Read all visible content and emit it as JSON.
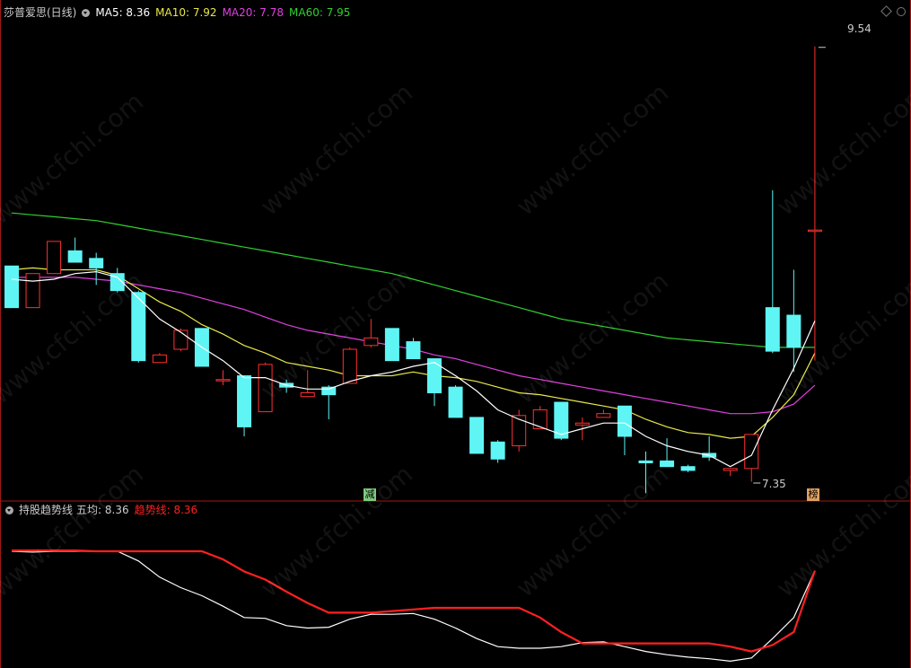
{
  "main_panel": {
    "title": "莎普爱思(日线)",
    "ma_labels": [
      {
        "label": "MA5: 8.36",
        "color": "#ffffff"
      },
      {
        "label": "MA10: 7.92",
        "color": "#e8e84a"
      },
      {
        "label": "MA20: 7.78",
        "color": "#e040e0"
      },
      {
        "label": "MA60: 7.95",
        "color": "#30d030"
      }
    ],
    "high_label": "9.54",
    "low_label": "7.35",
    "badges": [
      {
        "text": "减",
        "color": "#7ec97e"
      },
      {
        "text": "榜",
        "color": "#e0a060"
      }
    ]
  },
  "sub_panel": {
    "title": "持股趋势线",
    "avg_label": "五均: 8.36",
    "trend_label": "趋势线: 8.36",
    "trend_color": "#ff2020",
    "avg_color": "#ffffff"
  },
  "watermark": "www.cfchi.com",
  "colors": {
    "up": "#ff3030",
    "down": "#5ff5f5",
    "ma5": "#ffffff",
    "ma10": "#e8e84a",
    "ma20": "#e040e0",
    "ma60": "#30d030",
    "border": "#a01818"
  },
  "chart_data": {
    "type": "candlestick",
    "ylim": [
      7.2,
      9.7
    ],
    "candles": [
      {
        "o": 8.38,
        "h": 8.38,
        "l": 8.16,
        "c": 8.16
      },
      {
        "o": 8.16,
        "h": 8.34,
        "l": 8.16,
        "c": 8.34
      },
      {
        "o": 8.34,
        "h": 8.51,
        "l": 8.34,
        "c": 8.51
      },
      {
        "o": 8.46,
        "h": 8.53,
        "l": 8.4,
        "c": 8.4
      },
      {
        "o": 8.42,
        "h": 8.45,
        "l": 8.28,
        "c": 8.37
      },
      {
        "o": 8.34,
        "h": 8.37,
        "l": 8.24,
        "c": 8.25
      },
      {
        "o": 8.24,
        "h": 8.25,
        "l": 7.87,
        "c": 7.88
      },
      {
        "o": 7.87,
        "h": 7.92,
        "l": 7.87,
        "c": 7.91
      },
      {
        "o": 7.94,
        "h": 8.05,
        "l": 7.93,
        "c": 8.04
      },
      {
        "o": 8.05,
        "h": 8.05,
        "l": 7.85,
        "c": 7.85
      },
      {
        "o": 7.78,
        "h": 7.83,
        "l": 7.75,
        "c": 7.78
      },
      {
        "o": 7.8,
        "h": 7.8,
        "l": 7.48,
        "c": 7.53
      },
      {
        "o": 7.61,
        "h": 7.87,
        "l": 7.61,
        "c": 7.86
      },
      {
        "o": 7.76,
        "h": 7.78,
        "l": 7.71,
        "c": 7.74
      },
      {
        "o": 7.69,
        "h": 7.83,
        "l": 7.69,
        "c": 7.71
      },
      {
        "o": 7.74,
        "h": 7.75,
        "l": 7.57,
        "c": 7.7
      },
      {
        "o": 7.76,
        "h": 7.95,
        "l": 7.76,
        "c": 7.94
      },
      {
        "o": 7.96,
        "h": 8.1,
        "l": 7.95,
        "c": 8.0
      },
      {
        "o": 8.05,
        "h": 8.05,
        "l": 7.88,
        "c": 7.88
      },
      {
        "o": 7.98,
        "h": 8.0,
        "l": 7.89,
        "c": 7.89
      },
      {
        "o": 7.89,
        "h": 7.89,
        "l": 7.64,
        "c": 7.71
      },
      {
        "o": 7.74,
        "h": 7.75,
        "l": 7.58,
        "c": 7.58
      },
      {
        "o": 7.58,
        "h": 7.58,
        "l": 7.39,
        "c": 7.39
      },
      {
        "o": 7.45,
        "h": 7.46,
        "l": 7.34,
        "c": 7.36
      },
      {
        "o": 7.43,
        "h": 7.62,
        "l": 7.4,
        "c": 7.59
      },
      {
        "o": 7.52,
        "h": 7.64,
        "l": 7.52,
        "c": 7.62
      },
      {
        "o": 7.66,
        "h": 7.66,
        "l": 7.46,
        "c": 7.47
      },
      {
        "o": 7.54,
        "h": 7.58,
        "l": 7.46,
        "c": 7.55
      },
      {
        "o": 7.58,
        "h": 7.62,
        "l": 7.58,
        "c": 7.6
      },
      {
        "o": 7.64,
        "h": 7.64,
        "l": 7.38,
        "c": 7.48
      },
      {
        "o": 7.35,
        "h": 7.4,
        "l": 7.18,
        "c": 7.34
      },
      {
        "o": 7.35,
        "h": 7.47,
        "l": 7.35,
        "c": 7.32
      },
      {
        "o": 7.32,
        "h": 7.33,
        "l": 7.29,
        "c": 7.3
      },
      {
        "o": 7.39,
        "h": 7.48,
        "l": 7.35,
        "c": 7.37
      },
      {
        "o": 7.3,
        "h": 7.31,
        "l": 7.27,
        "c": 7.31
      },
      {
        "o": 7.31,
        "h": 7.49,
        "l": 7.24,
        "c": 7.49
      },
      {
        "o": 8.16,
        "h": 8.78,
        "l": 7.92,
        "c": 7.93
      },
      {
        "o": 8.12,
        "h": 8.36,
        "l": 7.82,
        "c": 7.95
      },
      {
        "o": 8.57,
        "h": 9.54,
        "l": 7.88,
        "c": 8.57
      }
    ],
    "ma5": [
      8.31,
      8.3,
      8.31,
      8.34,
      8.35,
      8.32,
      8.21,
      8.1,
      8.03,
      7.95,
      7.88,
      7.79,
      7.79,
      7.75,
      7.73,
      7.73,
      7.77,
      7.8,
      7.82,
      7.85,
      7.87,
      7.8,
      7.72,
      7.62,
      7.57,
      7.53,
      7.49,
      7.52,
      7.55,
      7.55,
      7.48,
      7.43,
      7.4,
      7.38,
      7.32,
      7.38,
      7.62,
      7.84,
      8.09
    ],
    "ma10": [
      8.36,
      8.37,
      8.36,
      8.36,
      8.36,
      8.33,
      8.26,
      8.19,
      8.14,
      8.07,
      8.02,
      7.96,
      7.92,
      7.87,
      7.85,
      7.83,
      7.8,
      7.8,
      7.8,
      7.82,
      7.8,
      7.79,
      7.77,
      7.74,
      7.71,
      7.7,
      7.68,
      7.66,
      7.64,
      7.62,
      7.57,
      7.53,
      7.5,
      7.49,
      7.47,
      7.48,
      7.58,
      7.7,
      7.92
    ],
    "ma20": [
      8.32,
      8.32,
      8.32,
      8.32,
      8.31,
      8.3,
      8.28,
      8.26,
      8.24,
      8.21,
      8.18,
      8.15,
      8.11,
      8.07,
      8.04,
      8.02,
      8.0,
      7.98,
      7.96,
      7.94,
      7.91,
      7.89,
      7.86,
      7.83,
      7.8,
      7.78,
      7.76,
      7.74,
      7.72,
      7.7,
      7.68,
      7.66,
      7.64,
      7.62,
      7.6,
      7.6,
      7.61,
      7.65,
      7.75
    ],
    "ma60": [
      8.66,
      8.65,
      8.64,
      8.63,
      8.62,
      8.6,
      8.58,
      8.56,
      8.54,
      8.52,
      8.5,
      8.48,
      8.46,
      8.44,
      8.42,
      8.4,
      8.38,
      8.36,
      8.34,
      8.31,
      8.28,
      8.25,
      8.22,
      8.19,
      8.16,
      8.13,
      8.1,
      8.08,
      8.06,
      8.04,
      8.02,
      8.0,
      7.99,
      7.98,
      7.97,
      7.96,
      7.95,
      7.95,
      7.95
    ],
    "sub_series": {
      "ylim": [
        7.2,
        9.0
      ],
      "avg": [
        8.6,
        8.59,
        8.6,
        8.6,
        8.6,
        8.6,
        8.48,
        8.28,
        8.15,
        8.05,
        7.92,
        7.78,
        7.77,
        7.68,
        7.65,
        7.66,
        7.76,
        7.82,
        7.82,
        7.83,
        7.76,
        7.65,
        7.52,
        7.42,
        7.4,
        7.4,
        7.42,
        7.47,
        7.48,
        7.42,
        7.36,
        7.32,
        7.29,
        7.27,
        7.24,
        7.28,
        7.52,
        7.78,
        8.36
      ],
      "trend": [
        8.61,
        8.61,
        8.61,
        8.61,
        8.6,
        8.6,
        8.6,
        8.6,
        8.6,
        8.6,
        8.5,
        8.35,
        8.25,
        8.1,
        7.96,
        7.84,
        7.84,
        7.84,
        7.86,
        7.88,
        7.9,
        7.9,
        7.9,
        7.9,
        7.9,
        7.78,
        7.6,
        7.46,
        7.46,
        7.46,
        7.46,
        7.46,
        7.46,
        7.46,
        7.42,
        7.36,
        7.44,
        7.6,
        8.36
      ]
    }
  }
}
